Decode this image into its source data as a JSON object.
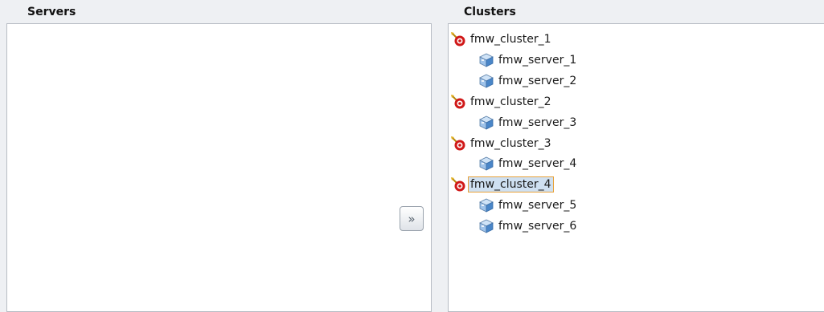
{
  "servers": {
    "header": "Servers",
    "items": []
  },
  "move_button": {
    "icon": "double-chevron-right-icon",
    "label": "»"
  },
  "clusters": {
    "header": "Clusters",
    "nodes": [
      {
        "label": "fmw_cluster_1",
        "type": "cluster",
        "icon": "cluster-target-icon",
        "selected": false,
        "children": [
          {
            "label": "fmw_server_1",
            "type": "server",
            "icon": "server-cube-icon"
          },
          {
            "label": "fmw_server_2",
            "type": "server",
            "icon": "server-cube-icon"
          }
        ]
      },
      {
        "label": "fmw_cluster_2",
        "type": "cluster",
        "icon": "cluster-target-icon",
        "selected": false,
        "children": [
          {
            "label": "fmw_server_3",
            "type": "server",
            "icon": "server-cube-icon"
          }
        ]
      },
      {
        "label": "fmw_cluster_3",
        "type": "cluster",
        "icon": "cluster-target-icon",
        "selected": false,
        "children": [
          {
            "label": "fmw_server_4",
            "type": "server",
            "icon": "server-cube-icon"
          }
        ]
      },
      {
        "label": "fmw_cluster_4",
        "type": "cluster",
        "icon": "cluster-target-icon",
        "selected": true,
        "children": [
          {
            "label": "fmw_server_5",
            "type": "server",
            "icon": "server-cube-icon"
          },
          {
            "label": "fmw_server_6",
            "type": "server",
            "icon": "server-cube-icon"
          }
        ]
      }
    ]
  },
  "colors": {
    "selection_bg": "#cfe0f1",
    "selection_border": "#e8a23a",
    "cluster_red": "#d01818",
    "server_blue": "#4a86c8"
  }
}
